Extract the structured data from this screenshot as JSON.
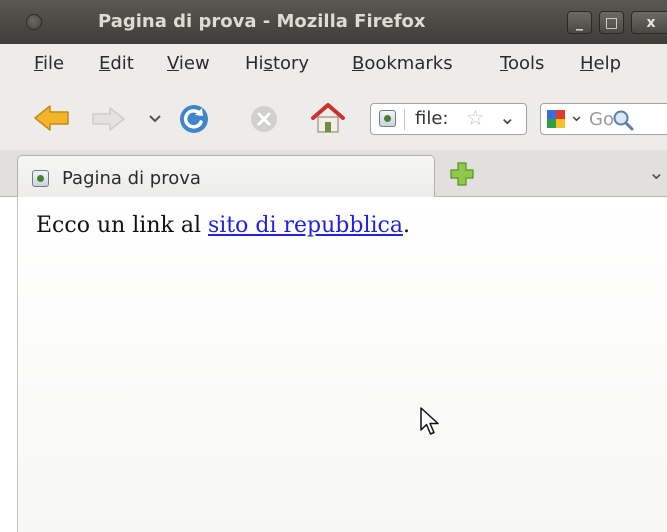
{
  "window": {
    "title": "Pagina di prova - Mozilla Firefox",
    "buttons": {
      "minimize": "_",
      "maximize": "□",
      "close": "x"
    }
  },
  "menubar": {
    "items": [
      {
        "label": "File",
        "accesskey": "F",
        "rest": "ile"
      },
      {
        "label": "Edit",
        "accesskey": "E",
        "rest": "dit"
      },
      {
        "label": "View",
        "accesskey": "V",
        "rest": "iew"
      },
      {
        "label": "History",
        "pre": "Hi",
        "accesskey": "s",
        "rest": "tory"
      },
      {
        "label": "Bookmarks",
        "accesskey": "B",
        "rest": "ookmarks"
      },
      {
        "label": "Tools",
        "accesskey": "T",
        "rest": "ools"
      },
      {
        "label": "Help",
        "accesskey": "H",
        "rest": "elp"
      }
    ]
  },
  "navbar": {
    "url_text": "file:",
    "search_text": "Go"
  },
  "tabs": [
    {
      "label": "Pagina di prova"
    }
  ],
  "content": {
    "text_before": "Ecco un link al ",
    "link_text": "sito di repubblica",
    "text_after": "."
  },
  "colors": {
    "link": "#2222dd",
    "titlebar": "#3e3d39"
  }
}
